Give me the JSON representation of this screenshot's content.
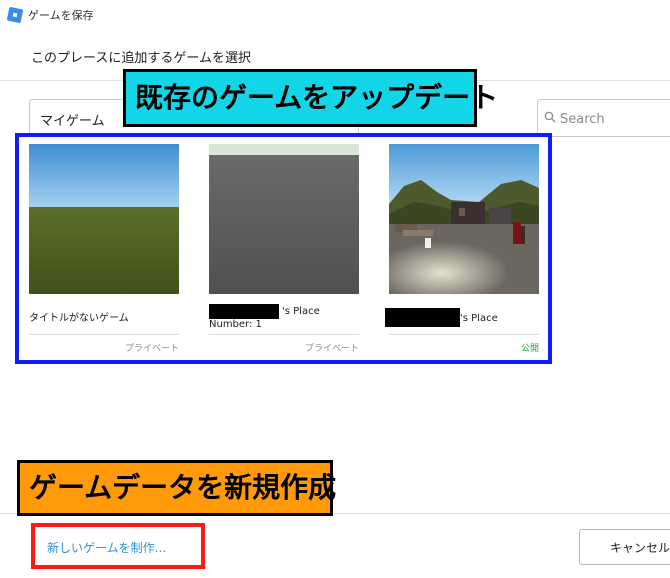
{
  "window": {
    "title": "ゲームを保存"
  },
  "subtitle": "このプレースに追加するゲームを選択",
  "game_filter": {
    "value": "マイゲーム"
  },
  "search": {
    "placeholder": "Search"
  },
  "annotations": {
    "update_existing": "既存のゲームをアップデート",
    "create_new": "ゲームデータを新規作成"
  },
  "games": [
    {
      "name": "タイトルがないゲーム",
      "status": "プライベート"
    },
    {
      "name_suffix": "'s Place",
      "name_line2": "Number: 1",
      "status": "プライベート"
    },
    {
      "name_suffix": "'s Place",
      "status": "公開"
    }
  ],
  "footer": {
    "new_game_label": "新しいゲームを制作...",
    "cancel_label": "キャンセル"
  },
  "colors": {
    "callout_update": "#12d6e8",
    "callout_new": "#ff9a0b",
    "highlight_blue": "#0f1cff",
    "highlight_red": "#ff1a1a",
    "link": "#2f8fd6",
    "public_status": "#21a54a"
  }
}
